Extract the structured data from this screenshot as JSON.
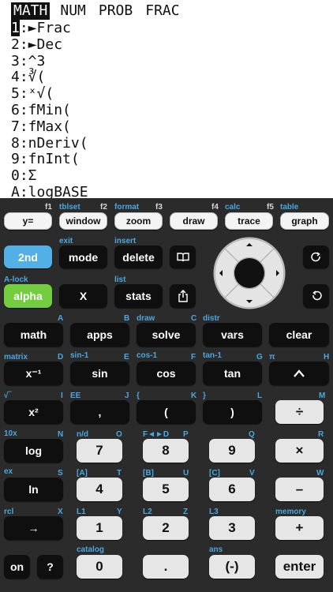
{
  "screen": {
    "tabs": [
      "MATH",
      "NUM",
      "PROB",
      "FRAC"
    ],
    "active_tab": 0,
    "items": [
      {
        "num": "1",
        "text": ":►Frac",
        "selected": true
      },
      {
        "num": "2",
        "text": ":►Dec"
      },
      {
        "num": "3",
        "text": ":^3"
      },
      {
        "num": "4",
        "text": ":∛("
      },
      {
        "num": "5",
        "text": ":ˣ√("
      },
      {
        "num": "6",
        "text": ":fMin("
      },
      {
        "num": "7",
        "text": ":fMax("
      },
      {
        "num": "8",
        "text": ":nDeriv("
      },
      {
        "num": "9",
        "text": ":fnInt("
      },
      {
        "num": "0",
        "text": ":Σ"
      },
      {
        "num": "A",
        "text": ":logBASE"
      }
    ]
  },
  "keys": {
    "y_eq": "y=",
    "window": "window",
    "zoom": "zoom",
    "draw_key": "draw",
    "trace": "trace",
    "graph": "graph",
    "second": "2nd",
    "mode": "mode",
    "delete": "delete",
    "alpha": "alpha",
    "xvar": "X",
    "stats": "stats",
    "math": "math",
    "apps": "apps",
    "solve": "solve",
    "vars": "vars",
    "clear": "clear",
    "inverse": "x⁻¹",
    "sin": "sin",
    "cos": "cos",
    "tan": "tan",
    "square": "x²",
    "comma": ",",
    "lparen": "(",
    "rparen": ")",
    "divide": "÷",
    "log": "log",
    "n7": "7",
    "n8": "8",
    "n9": "9",
    "multiply": "×",
    "ln": "ln",
    "n4": "4",
    "n5": "5",
    "n6": "6",
    "minus": "–",
    "store": "→",
    "n1": "1",
    "n2": "2",
    "n3": "3",
    "plus": "+",
    "on": "on",
    "help": "?",
    "n0": "0",
    "dot": ".",
    "negate": "(-)",
    "enter": "enter"
  },
  "labels": {
    "f1": "f1",
    "tblset": "tblset",
    "f2": "f2",
    "format": "format",
    "f3": "f3",
    "f4": "f4",
    "calc": "calc",
    "f5": "f5",
    "table": "table",
    "exit": "exit",
    "insert": "insert",
    "alock": "A-lock",
    "list": "list",
    "A": "A",
    "B": "B",
    "draw": "draw",
    "C": "C",
    "distr": "distr",
    "matrix": "matrix",
    "D": "D",
    "sin_inv": "sin-1",
    "E": "E",
    "cos_inv": "cos-1",
    "F": "F",
    "tan_inv": "tan-1",
    "G": "G",
    "pi": "π",
    "H": "H",
    "sqrt": "√‾",
    "I": "I",
    "EE": "EE",
    "J": "J",
    "lbrace": "{",
    "K": "K",
    "rbrace": "}",
    "L": "L",
    "M": "M",
    "tenx": "10x",
    "N": "N",
    "nd": "n/d",
    "O": "O",
    "fd": "F◄►D",
    "P": "P",
    "Q": "Q",
    "R": "R",
    "ex": "ex",
    "S": "S",
    "lbracket": "[A]",
    "T": "T",
    "B_mat": "[B]",
    "U": "U",
    "C_mat": "[C]",
    "V": "V",
    "W": "W",
    "rcl": "rcl",
    "X": "X",
    "L1": "L1",
    "Y": "Y",
    "L2": "L2",
    "Z": "Z",
    "L3": "L3",
    "memory": "memory",
    "catalog": "catalog",
    "ans": "ans"
  },
  "colors": {
    "accent_blue": "#52b0e6",
    "alpha_green": "#74cc3f",
    "pad_bg": "#2b2b2b"
  }
}
